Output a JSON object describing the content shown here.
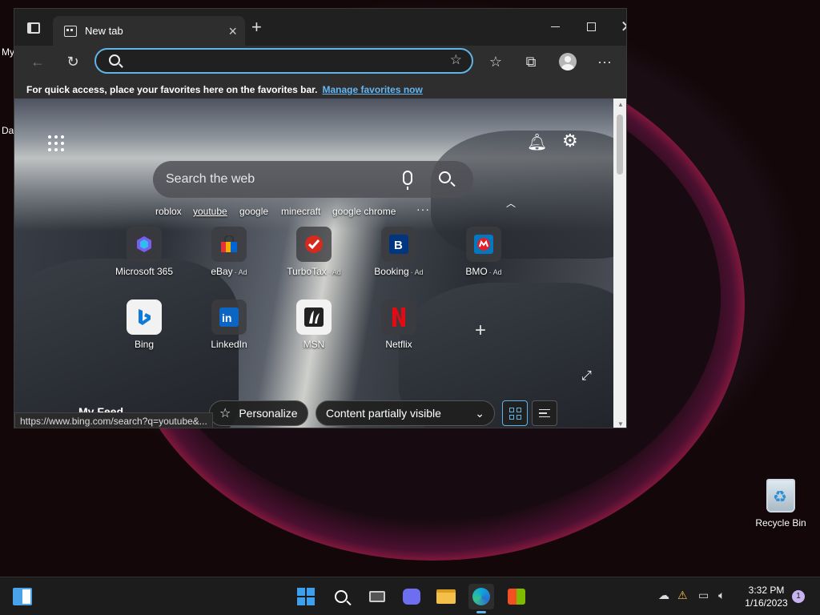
{
  "desktop": {
    "edge_labels": [
      "My",
      "Da"
    ],
    "recycle_bin_label": "Recycle Bin"
  },
  "browser": {
    "tab": {
      "title": "New tab"
    },
    "address": {
      "value": "",
      "placeholder": ""
    },
    "favorites_bar": {
      "message": "For quick access, place your favorites here on the favorites bar.",
      "link": "Manage favorites now"
    }
  },
  "newtab": {
    "search_placeholder": "Search the web",
    "trending": [
      "roblox",
      "youtube",
      "google",
      "minecraft",
      "google chrome"
    ],
    "more": "···",
    "tiles_row1": [
      {
        "label": "Microsoft 365",
        "ad": ""
      },
      {
        "label": "eBay",
        "ad": "· Ad"
      },
      {
        "label": "TurboTax",
        "ad": "· Ad"
      },
      {
        "label": "Booking",
        "ad": "· Ad"
      },
      {
        "label": "BMO",
        "ad": "· Ad"
      }
    ],
    "tiles_row2": [
      {
        "label": "Bing",
        "ad": ""
      },
      {
        "label": "LinkedIn",
        "ad": ""
      },
      {
        "label": "MSN",
        "ad": ""
      },
      {
        "label": "Netflix",
        "ad": ""
      }
    ],
    "personalize": "Personalize",
    "content_visibility": "Content partially visible",
    "feed_label": "My Feed",
    "status_url": "https://www.bing.com/search?q=youtube&..."
  },
  "taskbar": {
    "time": "3:32 PM",
    "date": "1/16/2023",
    "notification_count": "1"
  },
  "colors": {
    "accent": "#60b4e6",
    "bing_blue": "#0f7ad8",
    "netflix_red": "#e50914"
  }
}
